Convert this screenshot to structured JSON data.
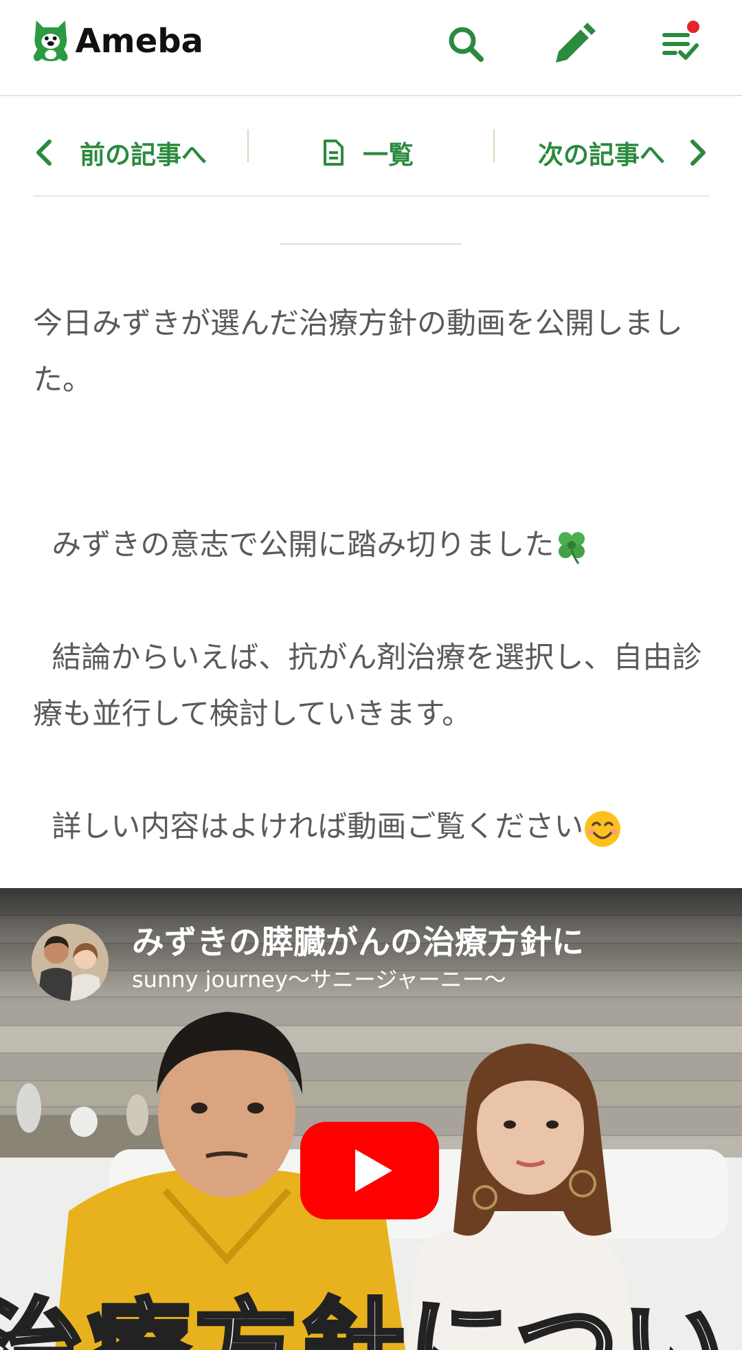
{
  "app": {
    "name": "Ameba"
  },
  "header": {
    "logo_text": "Ameba",
    "icons": [
      "search-icon",
      "pencil-icon",
      "feed-check-icon"
    ],
    "notification_dot_color": "#e3262d",
    "accent_color": "#2b8a3e"
  },
  "article_nav": {
    "prev_label": "前の記事へ",
    "list_label": "一覧",
    "next_label": "次の記事へ"
  },
  "article": {
    "paragraph1": "今日みずきが選んだ治療方針の動画を公開しました。",
    "paragraph2_line1": "みずきの意志で公開に踏み切りました",
    "paragraph2_line2": "結論からいえば、抗がん剤治療を選択し、自由診療も並行して検討していきます。",
    "paragraph3": "詳しい内容はよければ動画ご覧ください"
  },
  "video": {
    "title": "みずきの膵臓がんの治療方針に",
    "channel": "sunny journey〜サニージャーニー〜",
    "caption": "治療方針につい",
    "play_button_color": "#ff0000"
  }
}
